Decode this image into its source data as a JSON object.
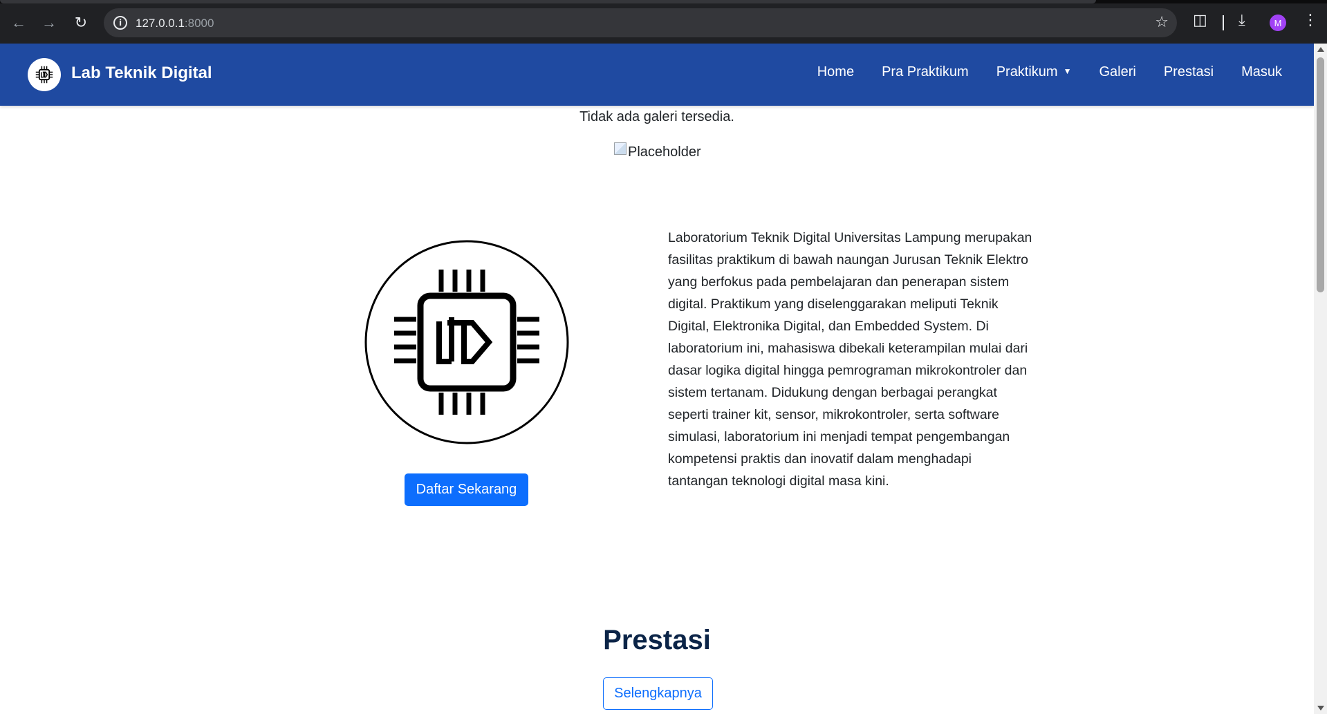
{
  "browser": {
    "url_host": "127.0.0.1",
    "url_port": ":8000",
    "avatar_initial": "M",
    "icons": {
      "back": "arrow-left-icon",
      "forward": "arrow-right-icon",
      "reload": "reload-icon",
      "info": "info-icon",
      "bookmark": "star-icon",
      "extensions": "puzzle-icon",
      "downloads": "download-icon",
      "menu": "kebab-menu-icon"
    }
  },
  "navbar": {
    "brand": "Lab Teknik Digital",
    "brand_logo": "ltd-chip-logo",
    "links": [
      "Home",
      "Pra Praktikum",
      "Praktikum",
      "Galeri",
      "Prestasi",
      "Masuk"
    ],
    "background_color": "#1f4aa1"
  },
  "gallery": {
    "empty_message": "Tidak ada galeri tersedia.",
    "image_alt": "Placeholder"
  },
  "hero": {
    "logo": "ltd-chip-logo",
    "cta_label": "Daftar Sekarang",
    "description": "Laboratorium Teknik Digital Universitas Lampung merupakan fasilitas praktikum di bawah naungan Jurusan Teknik Elektro yang berfokus pada pembelajaran dan penerapan sistem digital. Praktikum yang diselenggarakan meliputi Teknik Digital, Elektronika Digital, dan Embedded System. Di laboratorium ini, mahasiswa dibekali keterampilan mulai dari dasar logika digital hingga pemrograman mikrokontroler dan sistem tertanam. Didukung dengan berbagai perangkat seperti trainer kit, sensor, mikrokontroler, serta software simulasi, laboratorium ini menjadi tempat pengembangan kompetensi praktis dan inovatif dalam menghadapi tantangan teknologi digital masa kini."
  },
  "prestasi": {
    "title": "Prestasi",
    "more_label": "Selengkapnya"
  },
  "colors": {
    "primary": "#0d6efd",
    "heading": "#0b2447"
  }
}
